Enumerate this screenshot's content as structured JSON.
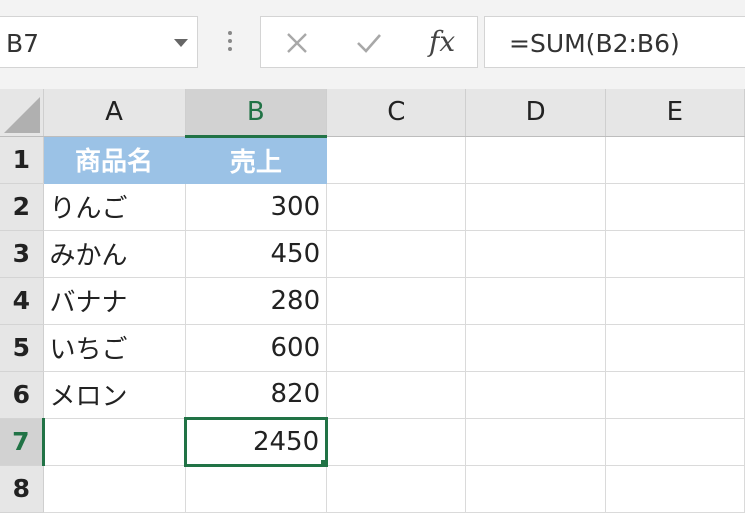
{
  "formula_bar": {
    "name_box": "B7",
    "formula": "=SUM(B2:B6)",
    "fx_label": "fx",
    "icons": {
      "cancel": "cancel-x-icon",
      "enter": "checkmark-icon",
      "insert_function": "fx-icon",
      "dropdown": "chevron-down-icon"
    }
  },
  "columns": [
    "A",
    "B",
    "C",
    "D",
    "E"
  ],
  "rows": [
    {
      "num": "1",
      "cells": [
        "商品名",
        "売上",
        "",
        "",
        ""
      ]
    },
    {
      "num": "2",
      "cells": [
        "りんご",
        "300",
        "",
        "",
        ""
      ]
    },
    {
      "num": "3",
      "cells": [
        "みかん",
        "450",
        "",
        "",
        ""
      ]
    },
    {
      "num": "4",
      "cells": [
        "バナナ",
        "280",
        "",
        "",
        ""
      ]
    },
    {
      "num": "5",
      "cells": [
        "いちご",
        "600",
        "",
        "",
        ""
      ]
    },
    {
      "num": "6",
      "cells": [
        "メロン",
        "820",
        "",
        "",
        ""
      ]
    },
    {
      "num": "7",
      "cells": [
        "",
        "2450",
        "",
        "",
        ""
      ]
    },
    {
      "num": "8",
      "cells": [
        "",
        "",
        "",
        "",
        ""
      ]
    }
  ],
  "active_cell": "B7",
  "colors": {
    "accent": "#217346",
    "header_fill": "#9bc2e6",
    "header_text": "#ffffff"
  }
}
